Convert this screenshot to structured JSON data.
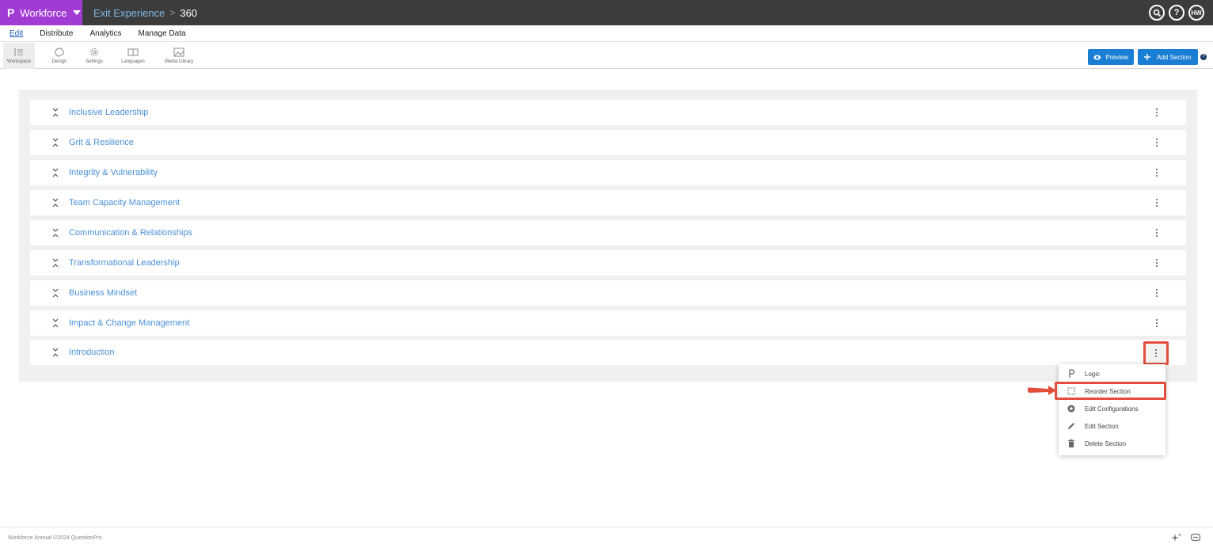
{
  "topbar": {
    "logo": "P",
    "product_name": "Workforce",
    "breadcrumb": [
      "Exit Experience",
      "360"
    ],
    "breadcrumb_sep": ">",
    "icons": [
      "search-icon",
      "help-icon",
      "user-avatar"
    ],
    "avatar_initials": "HW",
    "help_glyph": "?"
  },
  "menubar": {
    "items": [
      "Edit",
      "Distribute",
      "Analytics",
      "Manage Data"
    ]
  },
  "toolstrip": {
    "tools": [
      "Workspace",
      "Design",
      "Settings",
      "Languages",
      "Media Library"
    ],
    "preview_label": "Preview",
    "add_section_label": "Add Section",
    "help_glyph": "?"
  },
  "sections": [
    "Inclusive Leadership",
    "Grit & Resilience",
    "Integrity & Vulnerability",
    "Team Capacity Management",
    "Communication & Relationships",
    "Transformational Leadership",
    "Business Mindset",
    "Impact & Change Management",
    "Introduction"
  ],
  "context_menu": {
    "items": [
      {
        "label": "Logic",
        "icon": "logic-icon"
      },
      {
        "label": "Reorder Section",
        "icon": "reorder-icon"
      },
      {
        "label": "Edit Configurations",
        "icon": "gear-icon"
      },
      {
        "label": "Edit Section",
        "icon": "pencil-icon"
      },
      {
        "label": "Delete Section",
        "icon": "trash-icon"
      }
    ]
  },
  "footer": {
    "copyright": "Workforce Annual ©2024 QuestionPro"
  },
  "colors": {
    "product_purple": "#a13bd4",
    "topbar_dark": "#3c3c3c",
    "accent_blue": "#1a7fd4",
    "section_title_blue": "#4a90d9",
    "highlight_red": "#e34d3b"
  }
}
